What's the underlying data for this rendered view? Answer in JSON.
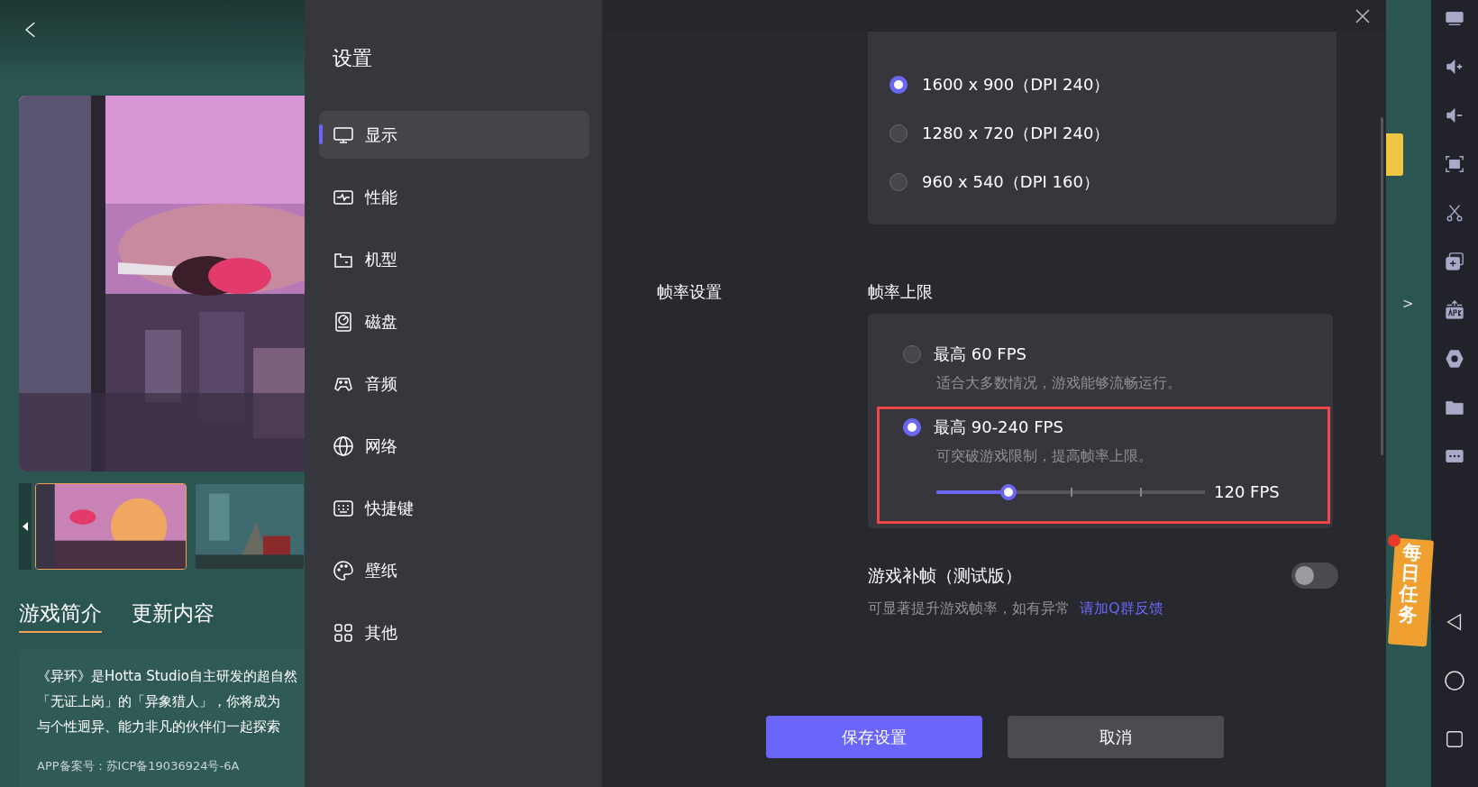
{
  "game_panel": {
    "thumbnails": [
      {
        "selected": true
      },
      {
        "selected": false
      }
    ],
    "tabs": [
      {
        "label": "游戏简介",
        "selected": true
      },
      {
        "label": "更新内容",
        "selected": false
      }
    ],
    "description": [
      "《异环》是Hotta Studio自主研发的超自然",
      "「无证上岗」的「异象猎人」，你将成为",
      "与个性迥异、能力非凡的伙伴们一起探索"
    ],
    "icp": "APP备案号：苏ICP备19036924号-6A"
  },
  "settings": {
    "title": "设置",
    "menu": [
      {
        "label": "显示",
        "selected": true
      },
      {
        "label": "性能",
        "selected": false
      },
      {
        "label": "机型",
        "selected": false
      },
      {
        "label": "磁盘",
        "selected": false
      },
      {
        "label": "音频",
        "selected": false
      },
      {
        "label": "网络",
        "selected": false
      },
      {
        "label": "快捷键",
        "selected": false
      },
      {
        "label": "壁纸",
        "selected": false
      },
      {
        "label": "其他",
        "selected": false
      }
    ]
  },
  "resolution": {
    "options": [
      {
        "label": "1600 x 900（DPI 240）",
        "selected": true
      },
      {
        "label": "1280 x 720（DPI 240）",
        "selected": false
      },
      {
        "label": "960 x 540（DPI 160）",
        "selected": false
      }
    ]
  },
  "frame_rate": {
    "section_label": "帧率设置",
    "heading": "帧率上限",
    "options": [
      {
        "title": "最高 60 FPS",
        "description": "适合大多数情况，游戏能够流畅运行。",
        "selected": false,
        "highlighted": false
      },
      {
        "title": "最高 90-240 FPS",
        "description": "可突破游戏限制，提高帧率上限。",
        "selected": true,
        "highlighted": true,
        "slider": {
          "level": 0.27,
          "reading": "120 FPS"
        }
      }
    ]
  },
  "interpolation": {
    "title": "游戏补帧（测试版）",
    "on": false,
    "description": "可显著提升游戏帧率，如有异常",
    "link": "请加Q群反馈"
  },
  "buttons": [
    {
      "label": "保存设置",
      "kind": "primary"
    },
    {
      "label": "取消",
      "kind": "secondary"
    }
  ],
  "side_strip": {
    "arrow": ">",
    "badge": "每日任务"
  }
}
